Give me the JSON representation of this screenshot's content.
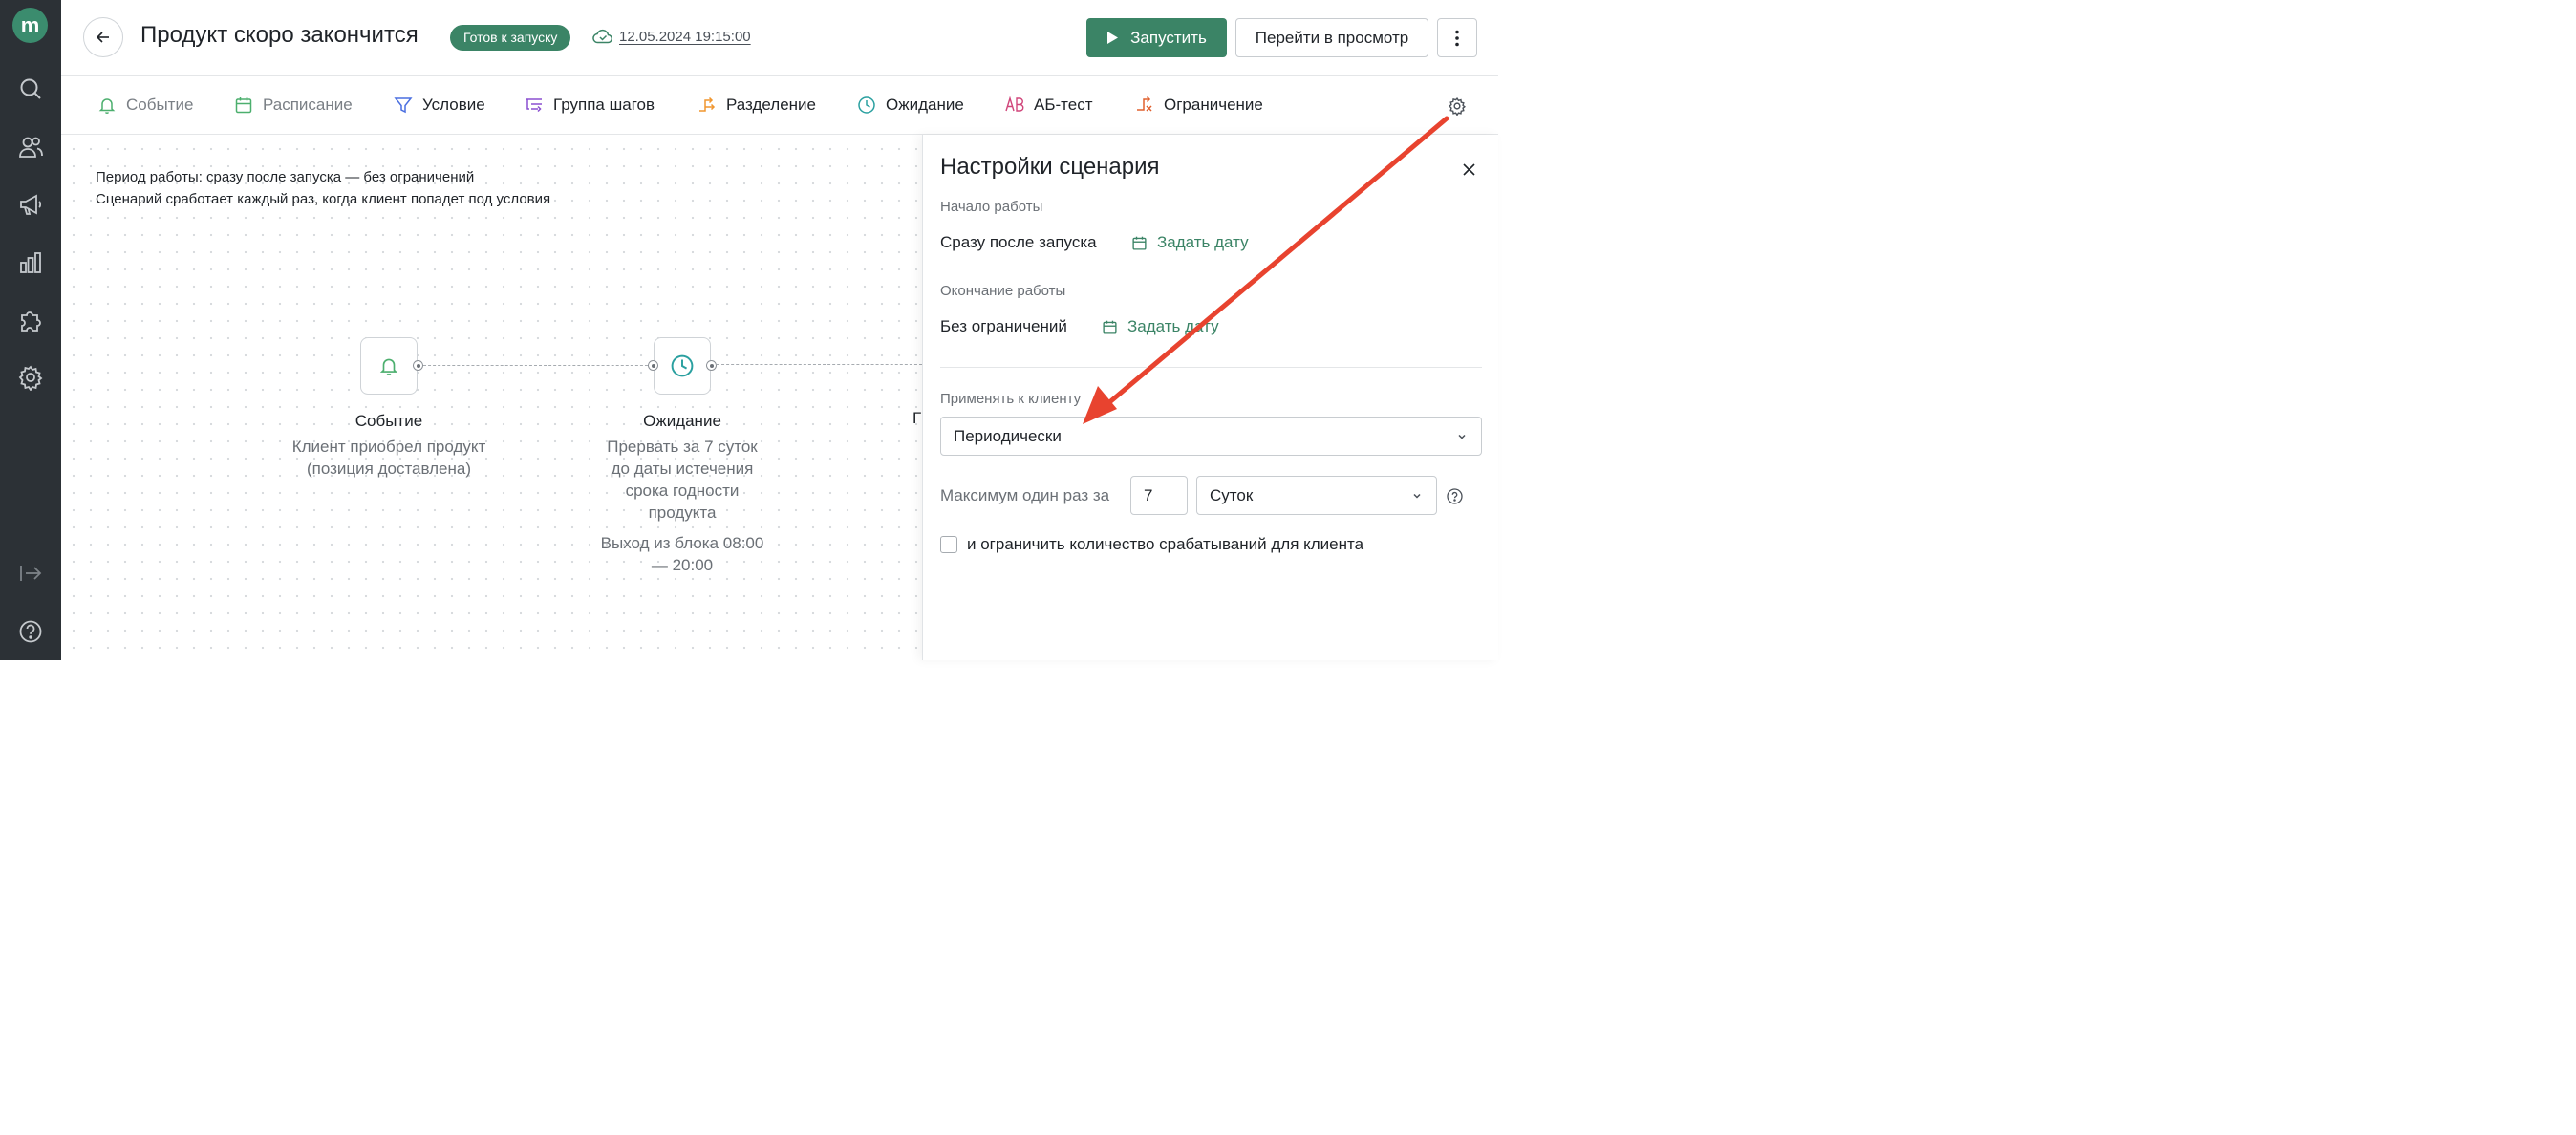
{
  "app": {
    "logo_letter": "m"
  },
  "sidebar": {
    "items": [
      {
        "icon": "search-icon"
      },
      {
        "icon": "users-icon"
      },
      {
        "icon": "megaphone-icon"
      },
      {
        "icon": "bar-chart-icon"
      },
      {
        "icon": "puzzle-icon"
      },
      {
        "icon": "gear-icon"
      }
    ],
    "bottom": [
      {
        "icon": "collapse-icon"
      },
      {
        "icon": "help-icon"
      }
    ]
  },
  "header": {
    "title": "Продукт скоро закончится",
    "status": "Готов к запуску",
    "saved_at": "12.05.2024 19:15:00",
    "run_label": "Запустить",
    "preview_label": "Перейти в просмотр"
  },
  "toolbar": {
    "items": [
      {
        "label": "Событие",
        "icon": "bell-icon",
        "muted": true
      },
      {
        "label": "Расписание",
        "icon": "calendar-icon",
        "muted": true
      },
      {
        "label": "Условие",
        "icon": "filter-icon"
      },
      {
        "label": "Группа шагов",
        "icon": "steps-group-icon"
      },
      {
        "label": "Разделение",
        "icon": "split-icon"
      },
      {
        "label": "Ожидание",
        "icon": "clock-icon"
      },
      {
        "label": "АБ-тест",
        "icon": "ab-test-icon"
      },
      {
        "label": "Ограничение",
        "icon": "limit-icon"
      }
    ]
  },
  "canvas": {
    "period_line": "Период работы: сразу после запуска — без ограничений",
    "trigger_line": "Сценарий сработает каждый раз, когда клиент попадет под условия",
    "nodes": [
      {
        "title": "Событие",
        "description": "Клиент приобрел продукт (позиция доставлена)",
        "icon": "bell-icon"
      },
      {
        "title": "Ожидание",
        "description": "Прервать за 7 суток до даты истечения срока годности продукта",
        "extra": "Выход из блока 08:00 — 20:00",
        "icon": "clock-icon"
      }
    ],
    "partial_node_letter": "Г"
  },
  "panel": {
    "title": "Настройки сценария",
    "start_label": "Начало работы",
    "start_value": "Сразу после запуска",
    "end_label": "Окончание работы",
    "end_value": "Без ограничений",
    "set_date_label": "Задать дату",
    "apply_label": "Применять к клиенту",
    "apply_value": "Периодически",
    "max_once_label": "Максимум один раз за",
    "max_once_number": "7",
    "max_once_unit": "Суток",
    "limit_checkbox_label": "и ограничить количество срабатываний для клиента",
    "limit_checked": false
  },
  "colors": {
    "accent_green": "#3b8466",
    "sidebar_bg": "#2c3136",
    "annotation_arrow": "#e8432f"
  }
}
